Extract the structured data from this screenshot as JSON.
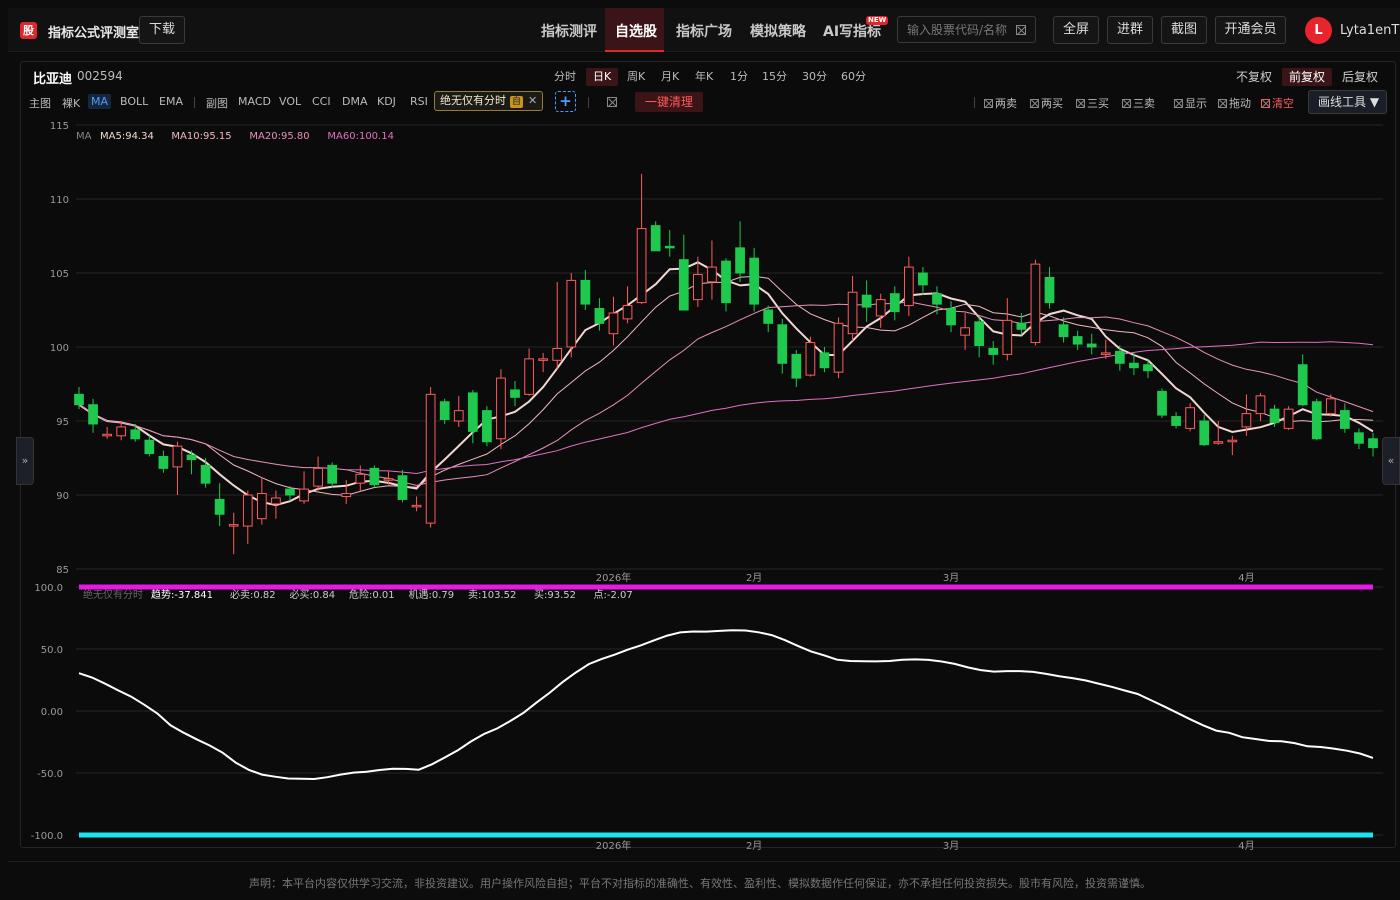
{
  "header": {
    "logo_char": "股",
    "app_title": "指标公式评测室",
    "download": "下载",
    "nav": [
      "指标测评",
      "自选股",
      "指标广场",
      "模拟策略",
      "AI写指标"
    ],
    "new_badge": "NEW",
    "search_placeholder": "输入股票代码/名称",
    "buttons": [
      "全屏",
      "进群",
      "截图",
      "开通会员"
    ],
    "avatar_letter": "L",
    "username": "Lyta1enT"
  },
  "panel": {
    "stock_name": "比亚迪",
    "stock_code": "002594",
    "periods": [
      "分时",
      "日K",
      "周K",
      "月K",
      "年K",
      "1分",
      "15分",
      "30分",
      "60分"
    ],
    "active_period": "日K",
    "adjust": [
      "不复权",
      "前复权",
      "后复权"
    ],
    "active_adjust": "前复权",
    "main_label": "主图",
    "main_indicators": [
      "裸K",
      "MA",
      "BOLL",
      "EMA"
    ],
    "sub_label": "副图",
    "sub_indicators": [
      "MACD",
      "VOL",
      "CCI",
      "DMA",
      "KDJ",
      "RSI"
    ],
    "formula_name": "绝无仅有分时",
    "formula_self": "自",
    "plus": "+",
    "clear_all": "一键清理",
    "toggles": [
      "两卖",
      "两买",
      "三买",
      "三卖",
      "显示",
      "拖动",
      "清空"
    ],
    "draw_tools": "画线工具 ▼",
    "left_tab": "»",
    "right_tab": "«"
  },
  "disclaimer": "声明：本平台内容仅供学习交流，非投资建议。用户操作风险自担；平台不对指标的准确性、有效性、盈利性、模拟数据作任何保证，亦不承担任何投资损失。股市有风险，投资需谨慎。",
  "main_legend": {
    "ma_label": "MA",
    "items": [
      {
        "text": "MA5:94.34",
        "color": "#f0d8d0"
      },
      {
        "text": "MA10:95.15",
        "color": "#f0b8c0"
      },
      {
        "text": "MA20:95.80",
        "color": "#e890b8"
      },
      {
        "text": "MA60:100.14",
        "color": "#e070c0"
      }
    ]
  },
  "sub_legend": {
    "name": "绝无仅有分时",
    "items": [
      "趋势:-37.841",
      "必卖:0.82",
      "必买:0.84",
      "危险:0.01",
      "机遇:0.79",
      "卖:103.52",
      "买:93.52",
      "点:-2.07"
    ]
  },
  "colors": {
    "up": "#ff5b5b",
    "down": "#1ec94e",
    "magenta": "#e619e6",
    "cyan": "#19e6f0",
    "accent": "#e0262d"
  },
  "chart_data": {
    "type": "candlestick",
    "main_ylim": [
      85,
      115
    ],
    "main_yticks": [
      85,
      90,
      95,
      100,
      105,
      110,
      115
    ],
    "x_labels": [
      {
        "text": "2026年",
        "index": 38
      },
      {
        "text": "2月",
        "index": 48
      },
      {
        "text": "3月",
        "index": 62
      },
      {
        "text": "4月",
        "index": 83
      }
    ],
    "candles": [
      [
        96.8,
        96.1,
        97.3,
        95.8
      ],
      [
        96.1,
        94.8,
        96.5,
        94.2
      ],
      [
        94.1,
        94.1,
        94.6,
        93.8
      ],
      [
        94.0,
        94.6,
        95.0,
        93.7
      ],
      [
        94.4,
        93.8,
        94.8,
        93.6
      ],
      [
        93.7,
        92.8,
        94.0,
        92.6
      ],
      [
        92.6,
        91.8,
        93.0,
        91.5
      ],
      [
        91.9,
        93.3,
        93.6,
        90.0
      ],
      [
        92.7,
        92.4,
        93.0,
        91.4
      ],
      [
        92.0,
        90.8,
        92.5,
        90.5
      ],
      [
        89.7,
        88.7,
        90.8,
        87.9
      ],
      [
        88.0,
        88.0,
        88.8,
        86.0
      ],
      [
        87.9,
        90.0,
        90.3,
        86.7
      ],
      [
        88.4,
        90.1,
        91.2,
        88.0
      ],
      [
        89.4,
        89.8,
        90.3,
        88.4
      ],
      [
        90.4,
        90.0,
        90.6,
        89.6
      ],
      [
        89.6,
        90.4,
        91.6,
        89.4
      ],
      [
        90.6,
        91.8,
        92.6,
        90.3
      ],
      [
        92.0,
        90.8,
        92.2,
        90.5
      ],
      [
        89.9,
        90.1,
        91.0,
        89.4
      ],
      [
        90.8,
        91.4,
        92.0,
        90.2
      ],
      [
        91.8,
        90.7,
        92.0,
        90.5
      ],
      [
        91.0,
        91.1,
        91.6,
        90.7
      ],
      [
        91.3,
        89.7,
        91.7,
        89.5
      ],
      [
        89.3,
        89.3,
        89.9,
        88.9
      ],
      [
        88.1,
        96.8,
        97.3,
        87.8
      ],
      [
        96.3,
        95.1,
        96.5,
        94.8
      ],
      [
        95.0,
        95.7,
        96.7,
        94.6
      ],
      [
        96.9,
        94.3,
        97.1,
        93.5
      ],
      [
        95.7,
        93.6,
        96.0,
        93.3
      ],
      [
        93.8,
        97.9,
        98.5,
        93.1
      ],
      [
        97.1,
        96.6,
        97.7,
        96.0
      ],
      [
        96.8,
        99.2,
        99.9,
        96.7
      ],
      [
        99.1,
        99.2,
        99.6,
        98.3
      ],
      [
        99.1,
        99.9,
        104.4,
        98.5
      ],
      [
        100.0,
        104.5,
        105.0,
        99.3
      ],
      [
        104.5,
        102.9,
        105.2,
        102.5
      ],
      [
        102.6,
        101.6,
        103.3,
        101.1
      ],
      [
        100.9,
        102.3,
        103.4,
        100.1
      ],
      [
        101.9,
        102.8,
        104.1,
        101.6
      ],
      [
        103.0,
        108.0,
        111.7,
        102.9
      ],
      [
        108.2,
        106.5,
        108.5,
        106.5
      ],
      [
        106.8,
        106.7,
        107.9,
        106.1
      ],
      [
        105.9,
        102.5,
        107.6,
        102.5
      ],
      [
        103.2,
        104.9,
        106.1,
        102.7
      ],
      [
        104.4,
        105.4,
        107.2,
        103.2
      ],
      [
        105.8,
        103.0,
        106.0,
        102.4
      ],
      [
        106.7,
        105.0,
        108.5,
        104.4
      ],
      [
        106.0,
        102.9,
        106.7,
        102.4
      ],
      [
        102.5,
        101.6,
        102.8,
        101.0
      ],
      [
        101.5,
        98.9,
        101.9,
        98.2
      ],
      [
        99.5,
        97.9,
        99.8,
        97.3
      ],
      [
        98.1,
        100.3,
        100.7,
        98.0
      ],
      [
        99.6,
        98.6,
        100.0,
        98.3
      ],
      [
        98.3,
        101.6,
        102.0,
        97.9
      ],
      [
        100.9,
        103.7,
        104.8,
        100.4
      ],
      [
        103.5,
        102.7,
        104.5,
        101.7
      ],
      [
        102.1,
        103.2,
        103.6,
        101.3
      ],
      [
        103.6,
        102.4,
        104.1,
        101.8
      ],
      [
        102.8,
        105.4,
        106.1,
        102.1
      ],
      [
        105.0,
        104.2,
        105.4,
        103.5
      ],
      [
        103.6,
        102.9,
        104.1,
        102.2
      ],
      [
        102.6,
        101.5,
        103.1,
        101.0
      ],
      [
        100.8,
        101.3,
        102.3,
        99.8
      ],
      [
        101.7,
        100.1,
        102.1,
        99.3
      ],
      [
        99.9,
        99.5,
        100.4,
        98.8
      ],
      [
        99.5,
        101.8,
        103.3,
        99.1
      ],
      [
        101.6,
        101.2,
        102.3,
        100.8
      ],
      [
        100.3,
        105.6,
        105.9,
        100.1
      ],
      [
        104.7,
        103.0,
        105.4,
        102.6
      ],
      [
        101.5,
        100.7,
        102.0,
        100.3
      ],
      [
        100.7,
        100.2,
        101.1,
        99.8
      ],
      [
        100.2,
        100.0,
        100.9,
        99.5
      ],
      [
        99.6,
        99.6,
        100.5,
        99.2
      ],
      [
        99.7,
        98.9,
        100.1,
        98.4
      ],
      [
        98.9,
        98.6,
        99.6,
        98.1
      ],
      [
        98.8,
        98.4,
        99.2,
        97.9
      ],
      [
        97.0,
        95.4,
        97.2,
        95.2
      ],
      [
        95.3,
        94.7,
        95.6,
        94.5
      ],
      [
        94.5,
        95.9,
        96.2,
        94.3
      ],
      [
        95.0,
        93.4,
        95.4,
        93.3
      ],
      [
        93.6,
        93.6,
        95.0,
        93.4
      ],
      [
        93.7,
        93.7,
        94.0,
        92.7
      ],
      [
        94.6,
        95.5,
        96.8,
        94.0
      ],
      [
        95.5,
        96.7,
        96.9,
        95.0
      ],
      [
        95.8,
        94.9,
        96.1,
        94.6
      ],
      [
        94.5,
        95.8,
        96.0,
        94.4
      ],
      [
        98.8,
        96.1,
        99.5,
        96.0
      ],
      [
        96.3,
        93.8,
        96.5,
        93.7
      ],
      [
        95.5,
        96.5,
        96.8,
        95.3
      ],
      [
        95.7,
        94.5,
        96.2,
        94.2
      ],
      [
        94.2,
        93.5,
        94.5,
        93.1
      ],
      [
        93.8,
        93.2,
        94.2,
        92.6
      ]
    ],
    "sub_ylim": [
      -100,
      100
    ],
    "sub_yticks": [
      100.0,
      50.0,
      0.0,
      -50.0,
      -100.0
    ],
    "trend_line": [
      30.5,
      27.0,
      22.0,
      16.6,
      11.5,
      5.0,
      -2.0,
      -11.5,
      -17.5,
      -22.8,
      -27.8,
      -33.7,
      -41.7,
      -47.5,
      -51.3,
      -53.0,
      -54.4,
      -54.7,
      -54.8,
      -53.4,
      -51.3,
      -49.7,
      -49.0,
      -47.6,
      -46.6,
      -46.7,
      -47.3,
      -43.0,
      -37.4,
      -31.5,
      -24.5,
      -18.5,
      -14.0,
      -8.1,
      -1.5,
      6.8,
      14.6,
      23.3,
      31.0,
      37.8,
      42.0,
      45.5,
      49.5,
      53.0,
      57.0,
      60.8,
      63.4,
      64.1,
      64.0,
      64.6,
      65.2,
      64.9,
      63.5,
      61.2,
      57.2,
      52.5,
      48.1,
      44.9,
      41.4,
      40.3,
      40.1,
      40.0,
      40.3,
      41.3,
      41.6,
      41.2,
      39.9,
      38.0,
      35.2,
      33.0,
      31.8,
      32.2,
      32.2,
      31.5,
      29.9,
      28.1,
      26.5,
      24.7,
      22.1,
      19.5,
      16.5,
      13.7,
      8.8,
      3.8,
      -1.4,
      -6.6,
      -11.5,
      -15.8,
      -17.6,
      -21.1,
      -22.6,
      -24.1,
      -24.4,
      -25.9,
      -28.5,
      -29.0,
      -30.3,
      -32.0,
      -34.3,
      -37.8
    ]
  }
}
